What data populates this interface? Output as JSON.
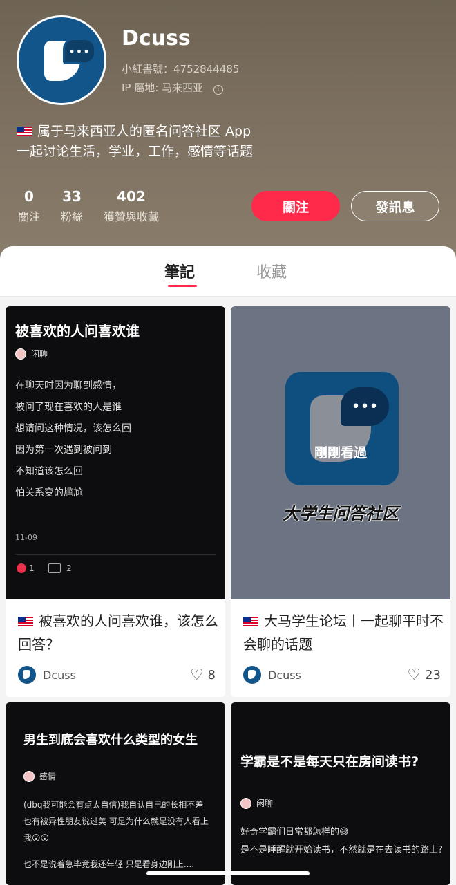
{
  "profile": {
    "name": "Dcuss",
    "red_id": "小紅書號：4752844485",
    "ip": "IP 屬地: 马来西亚",
    "bio_line1": "属于马来西亚人的匿名问答社区 App",
    "bio_line2": "一起讨论生活，学业，工作，感情等话题",
    "bio_flag": "malaysia-flag-icon"
  },
  "stats": [
    {
      "value": "0",
      "label": "關注"
    },
    {
      "value": "33",
      "label": "粉絲"
    },
    {
      "value": "402",
      "label": "獲贊與收藏"
    }
  ],
  "actions": {
    "follow": "關注",
    "message": "發訊息"
  },
  "tabs": [
    {
      "label": "筆記",
      "active": true
    },
    {
      "label": "收藏",
      "active": false
    }
  ],
  "notes": [
    {
      "cover_title": "被喜欢的人问喜欢谁",
      "cover_tag": "闲聊",
      "cover_lines": [
        "在聊天时因为聊到感情，",
        "被问了现在喜欢的人是谁",
        "想请问这种情况，该怎么回",
        "因为第一次遇到被问到",
        "不知道该怎么回",
        "怕关系变的尴尬"
      ],
      "cover_date": "11-09",
      "cover_likes": "1",
      "cover_comments": "2",
      "title": "被喜欢的人问喜欢谁，该怎么回答？",
      "author": "Dcuss",
      "likes": "8"
    },
    {
      "cover_overlay": "剛剛看過",
      "cover_banner": "大学生问答社区",
      "title": "大马学生论坛丨一起聊平时不会聊的话题",
      "author": "Dcuss",
      "likes": "23"
    },
    {
      "cover_title": "男生到底会喜欢什么类型的女生",
      "cover_tag": "感情",
      "cover_lines": [
        "(dbq我可能会有点太自信)我自认自己的长相不差 也有被异性朋友说过美 可是为什么就是没有人看上我😮😮",
        "也不是说着急毕竟我还年轻 只是看身边刚上...."
      ]
    },
    {
      "cover_title": "学霸是不是每天只在房间读书?",
      "cover_tag": "闲聊",
      "cover_lines": [
        "好奇学霸们日常都怎样的😅",
        "是不是睡醒就开始读书，不然就是在去读书的路上?"
      ]
    }
  ],
  "colors": {
    "accent": "#ff2a4a",
    "brand_blue": "#12558a"
  }
}
